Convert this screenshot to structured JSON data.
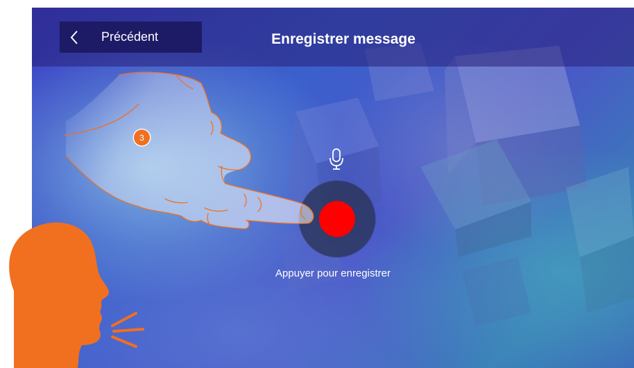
{
  "header": {
    "back_label": "Précédent",
    "title": "Enregistrer message"
  },
  "main": {
    "hint_text": "Appuyer pour enregistrer",
    "record_color": "#ff0000"
  },
  "annotation": {
    "step_number": "3",
    "accent_color": "#f07020"
  },
  "icons": {
    "back": "chevron-left-icon",
    "microphone": "microphone-icon",
    "record": "record-dot-icon",
    "hand": "pointing-hand-icon",
    "speaker": "speaking-head-icon"
  }
}
